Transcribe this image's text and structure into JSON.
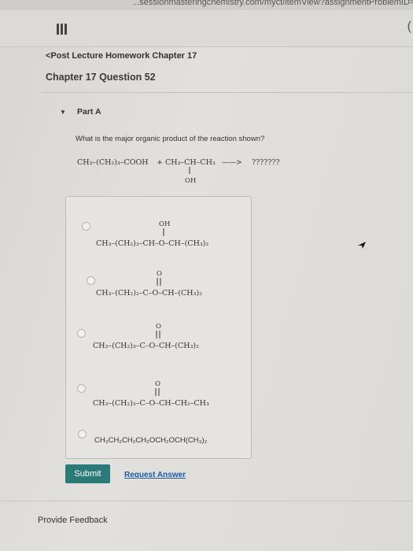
{
  "browser": {
    "url_fragment": "...sessionmasteringchemistry.com/myct/itemView?assignmentProblemID="
  },
  "header": {
    "menu_icon": "hamburger-icon",
    "right_glyph": "("
  },
  "nav": {
    "back_link": "<Post Lecture Homework Chapter 17"
  },
  "page": {
    "title": "Chapter 17 Question 52"
  },
  "part": {
    "toggle_icon": "triangle-down-icon",
    "label": "Part A"
  },
  "question": {
    "text": "What is the major organic product of the reaction shown?"
  },
  "reaction": {
    "reactant1": "CH₃–(CH₂)₃–COOH",
    "plus": "+",
    "reactant2": "CH₃–CH–CH₃",
    "reactant2_substituent": "OH",
    "arrow": "——>",
    "product": "???????"
  },
  "choices": [
    {
      "formula": "CH₃–(CH₂)₃–CH–O–CH–(CH₃)₂",
      "top_group": "OH",
      "type": "single"
    },
    {
      "formula": "CH₃–(CH₂)₂–C–O–CH–(CH₃)₂",
      "top_group": "O",
      "type": "double"
    },
    {
      "formula": "CH₃–(CH₂)₃–C–O–CH–(CH₃)₂",
      "top_group": "O",
      "type": "double"
    },
    {
      "formula": "CH₃–(CH₂)₃–C–O–CH–CH₂–CH₃",
      "top_group": "O",
      "type": "double"
    },
    {
      "formula": "CH₃CH₂CH₂CH₂OCH₂OCH(CH₃)₂",
      "top_group": "",
      "type": "none"
    }
  ],
  "actions": {
    "submit": "Submit",
    "request_answer": "Request Answer"
  },
  "footer": {
    "feedback": "Provide Feedback"
  },
  "colors": {
    "submit_bg": "#2c7a78",
    "link": "#1d5aa3"
  }
}
